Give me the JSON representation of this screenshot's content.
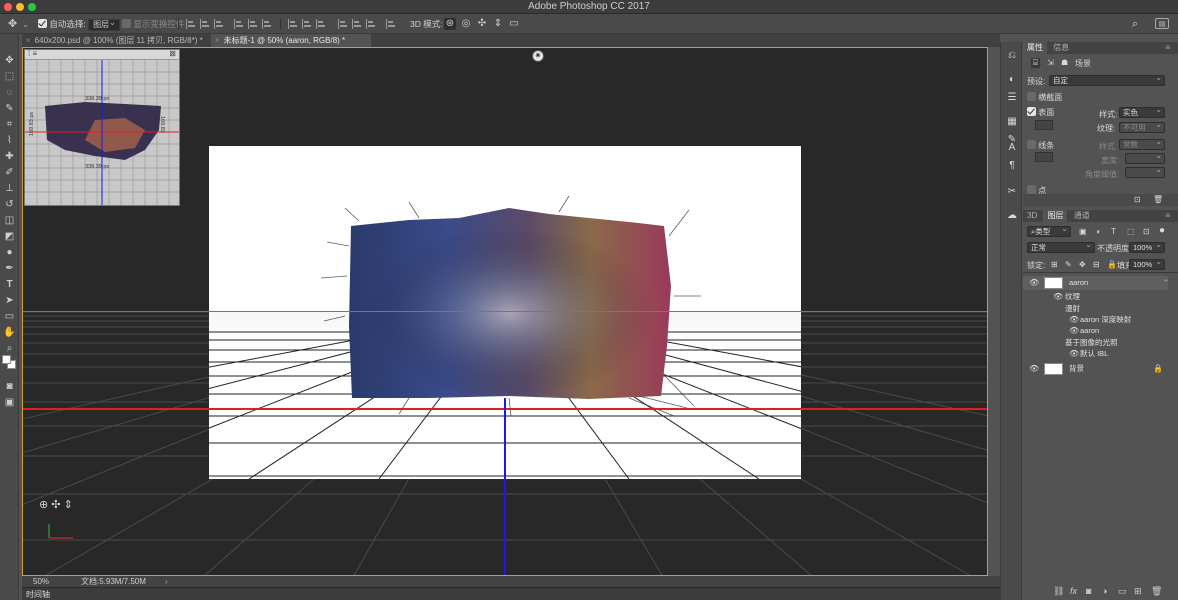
{
  "window": {
    "title": "Adobe Photoshop CC 2017"
  },
  "options_bar": {
    "auto_select_label": "自动选择:",
    "auto_select_value": "图层",
    "show_transform_label": "显示变换控件",
    "mode_3d_label": "3D 模式:"
  },
  "tabs": [
    {
      "label": "640x200.psd @ 100% (图层 11 拷贝, RGB/8*) *",
      "active": false
    },
    {
      "label": "未标题-1 @ 50% (aaron, RGB/8) *",
      "active": true
    }
  ],
  "navigator": {
    "width_label": "338.39 px",
    "height_label": "169.83 px",
    "bottom_label": "338.39 px",
    "left_label": "169.83 px"
  },
  "status_bar": {
    "zoom": "50%",
    "doc_info": "文档:5.93M/7.50M"
  },
  "timeline_label": "时间轴",
  "properties_panel": {
    "tabs": [
      "属性",
      "信息"
    ],
    "scene_label": "场景",
    "preset_label": "预设:",
    "preset_value": "自定",
    "cross_section_label": "横截面",
    "surface_label": "表面",
    "surface_style_label": "样式:",
    "surface_style_value": "实色",
    "texture_label": "纹理:",
    "texture_value": "不可用",
    "lines_label": "线条",
    "lines_style_label": "样式:",
    "lines_style_value": "常数",
    "width_label": "宽度:",
    "angle_label": "角度阈值:",
    "points_label": "点"
  },
  "layers_panel": {
    "tabs": [
      "3D",
      "图层",
      "通道"
    ],
    "filter_label": "类型",
    "blend_mode": "正常",
    "opacity_label": "不透明度:",
    "opacity_value": "100%",
    "lock_label": "锁定:",
    "fill_label": "填充:",
    "fill_value": "100%",
    "layers": [
      {
        "name": "aaron",
        "level": 0,
        "eye": true,
        "selected": true,
        "thumb": true
      },
      {
        "name": "纹理",
        "level": 1,
        "eye": true
      },
      {
        "name": "漫射",
        "level": 2,
        "eye": false
      },
      {
        "name": "aaron 深度映射",
        "level": 3,
        "eye": true
      },
      {
        "name": "aaron",
        "level": 3,
        "eye": true
      },
      {
        "name": "基于图像的光照",
        "level": 2,
        "eye": false
      },
      {
        "name": "默认 IBL",
        "level": 3,
        "eye": true
      },
      {
        "name": "背景",
        "level": 0,
        "eye": true,
        "thumb": true,
        "locked": true
      }
    ]
  },
  "colors": {
    "accent_border": "#c9a22a",
    "guide_red": "#e02020",
    "guide_blue": "#1a1aee"
  }
}
